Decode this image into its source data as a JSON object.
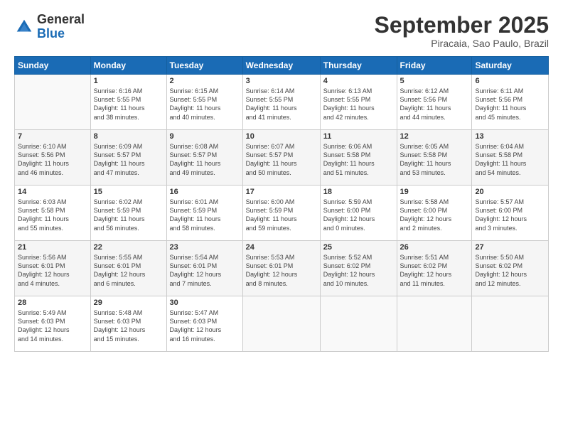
{
  "header": {
    "logo_general": "General",
    "logo_blue": "Blue",
    "month_title": "September 2025",
    "subtitle": "Piracaia, Sao Paulo, Brazil"
  },
  "days_of_week": [
    "Sunday",
    "Monday",
    "Tuesday",
    "Wednesday",
    "Thursday",
    "Friday",
    "Saturday"
  ],
  "weeks": [
    [
      {
        "day": "",
        "text": ""
      },
      {
        "day": "1",
        "text": "Sunrise: 6:16 AM\nSunset: 5:55 PM\nDaylight: 11 hours\nand 38 minutes."
      },
      {
        "day": "2",
        "text": "Sunrise: 6:15 AM\nSunset: 5:55 PM\nDaylight: 11 hours\nand 40 minutes."
      },
      {
        "day": "3",
        "text": "Sunrise: 6:14 AM\nSunset: 5:55 PM\nDaylight: 11 hours\nand 41 minutes."
      },
      {
        "day": "4",
        "text": "Sunrise: 6:13 AM\nSunset: 5:55 PM\nDaylight: 11 hours\nand 42 minutes."
      },
      {
        "day": "5",
        "text": "Sunrise: 6:12 AM\nSunset: 5:56 PM\nDaylight: 11 hours\nand 44 minutes."
      },
      {
        "day": "6",
        "text": "Sunrise: 6:11 AM\nSunset: 5:56 PM\nDaylight: 11 hours\nand 45 minutes."
      }
    ],
    [
      {
        "day": "7",
        "text": "Sunrise: 6:10 AM\nSunset: 5:56 PM\nDaylight: 11 hours\nand 46 minutes."
      },
      {
        "day": "8",
        "text": "Sunrise: 6:09 AM\nSunset: 5:57 PM\nDaylight: 11 hours\nand 47 minutes."
      },
      {
        "day": "9",
        "text": "Sunrise: 6:08 AM\nSunset: 5:57 PM\nDaylight: 11 hours\nand 49 minutes."
      },
      {
        "day": "10",
        "text": "Sunrise: 6:07 AM\nSunset: 5:57 PM\nDaylight: 11 hours\nand 50 minutes."
      },
      {
        "day": "11",
        "text": "Sunrise: 6:06 AM\nSunset: 5:58 PM\nDaylight: 11 hours\nand 51 minutes."
      },
      {
        "day": "12",
        "text": "Sunrise: 6:05 AM\nSunset: 5:58 PM\nDaylight: 11 hours\nand 53 minutes."
      },
      {
        "day": "13",
        "text": "Sunrise: 6:04 AM\nSunset: 5:58 PM\nDaylight: 11 hours\nand 54 minutes."
      }
    ],
    [
      {
        "day": "14",
        "text": "Sunrise: 6:03 AM\nSunset: 5:58 PM\nDaylight: 11 hours\nand 55 minutes."
      },
      {
        "day": "15",
        "text": "Sunrise: 6:02 AM\nSunset: 5:59 PM\nDaylight: 11 hours\nand 56 minutes."
      },
      {
        "day": "16",
        "text": "Sunrise: 6:01 AM\nSunset: 5:59 PM\nDaylight: 11 hours\nand 58 minutes."
      },
      {
        "day": "17",
        "text": "Sunrise: 6:00 AM\nSunset: 5:59 PM\nDaylight: 11 hours\nand 59 minutes."
      },
      {
        "day": "18",
        "text": "Sunrise: 5:59 AM\nSunset: 6:00 PM\nDaylight: 12 hours\nand 0 minutes."
      },
      {
        "day": "19",
        "text": "Sunrise: 5:58 AM\nSunset: 6:00 PM\nDaylight: 12 hours\nand 2 minutes."
      },
      {
        "day": "20",
        "text": "Sunrise: 5:57 AM\nSunset: 6:00 PM\nDaylight: 12 hours\nand 3 minutes."
      }
    ],
    [
      {
        "day": "21",
        "text": "Sunrise: 5:56 AM\nSunset: 6:01 PM\nDaylight: 12 hours\nand 4 minutes."
      },
      {
        "day": "22",
        "text": "Sunrise: 5:55 AM\nSunset: 6:01 PM\nDaylight: 12 hours\nand 6 minutes."
      },
      {
        "day": "23",
        "text": "Sunrise: 5:54 AM\nSunset: 6:01 PM\nDaylight: 12 hours\nand 7 minutes."
      },
      {
        "day": "24",
        "text": "Sunrise: 5:53 AM\nSunset: 6:01 PM\nDaylight: 12 hours\nand 8 minutes."
      },
      {
        "day": "25",
        "text": "Sunrise: 5:52 AM\nSunset: 6:02 PM\nDaylight: 12 hours\nand 10 minutes."
      },
      {
        "day": "26",
        "text": "Sunrise: 5:51 AM\nSunset: 6:02 PM\nDaylight: 12 hours\nand 11 minutes."
      },
      {
        "day": "27",
        "text": "Sunrise: 5:50 AM\nSunset: 6:02 PM\nDaylight: 12 hours\nand 12 minutes."
      }
    ],
    [
      {
        "day": "28",
        "text": "Sunrise: 5:49 AM\nSunset: 6:03 PM\nDaylight: 12 hours\nand 14 minutes."
      },
      {
        "day": "29",
        "text": "Sunrise: 5:48 AM\nSunset: 6:03 PM\nDaylight: 12 hours\nand 15 minutes."
      },
      {
        "day": "30",
        "text": "Sunrise: 5:47 AM\nSunset: 6:03 PM\nDaylight: 12 hours\nand 16 minutes."
      },
      {
        "day": "",
        "text": ""
      },
      {
        "day": "",
        "text": ""
      },
      {
        "day": "",
        "text": ""
      },
      {
        "day": "",
        "text": ""
      }
    ]
  ]
}
